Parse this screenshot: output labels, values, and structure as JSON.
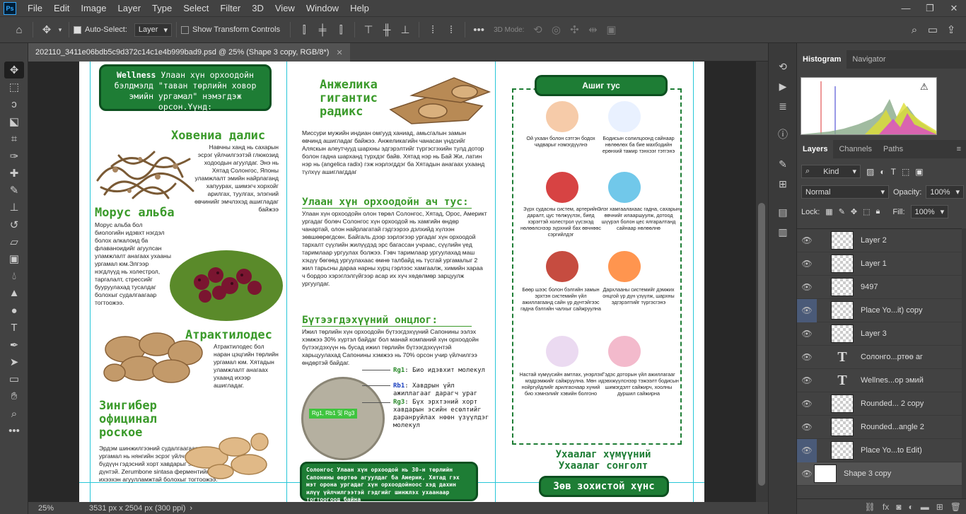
{
  "menubar": {
    "logo": "Ps",
    "items": [
      "File",
      "Edit",
      "Image",
      "Layer",
      "Type",
      "Select",
      "Filter",
      "3D",
      "View",
      "Window",
      "Help"
    ]
  },
  "options": {
    "auto_select_label": "Auto-Select:",
    "auto_select_value": "Layer",
    "transform_controls_label": "Show Transform Controls",
    "mode_3d_label": "3D Mode:"
  },
  "document": {
    "tab_title": "202110_3411e06bdb5c9d372c14c1e4b999bad9.psd @ 25% (Shape 3 copy, RGB/8*)",
    "zoom": "25%",
    "dimensions": "3531 px x 2504 px (300 ppi)"
  },
  "panels": {
    "histogram_tab": "Histogram",
    "navigator_tab": "Navigator",
    "layers_tab": "Layers",
    "channels_tab": "Channels",
    "paths_tab": "Paths",
    "kind_label": "Kind",
    "blend_mode": "Normal",
    "opacity_label": "Opacity:",
    "opacity_value": "100%",
    "lock_label": "Lock:",
    "fill_label": "Fill:",
    "fill_value": "100%"
  },
  "layers": [
    {
      "name": "Layer 2",
      "type": "pixel",
      "hl": false
    },
    {
      "name": "Layer 1",
      "type": "pixel",
      "hl": false
    },
    {
      "name": "9497",
      "type": "pixel",
      "hl": false
    },
    {
      "name": "Place Yo...it) copy",
      "type": "smart",
      "hl": true
    },
    {
      "name": "Layer 3",
      "type": "pixel",
      "hl": false
    },
    {
      "name": "Солонго...ртөө аг",
      "type": "text",
      "hl": false
    },
    {
      "name": "Wellnes...ор эмий",
      "type": "text",
      "hl": false
    },
    {
      "name": "Rounded... 2 copy",
      "type": "smart",
      "hl": false
    },
    {
      "name": "Rounded...angle 2",
      "type": "smart",
      "hl": false
    },
    {
      "name": "Place Yo...to Edit)",
      "type": "smart",
      "hl": true
    },
    {
      "name": "Shape 3 copy",
      "type": "shape",
      "hl": false,
      "sel": true
    }
  ],
  "canvas": {
    "header_box": {
      "brand": "Wellness",
      "text": "Улаан хүн орхоодойн бэлдмэлд \"таван төрлийн ховор эмийн ургамал\" нэмэгдэж орсон.Үүнд:"
    },
    "hovenia": {
      "title": "Ховениа далис",
      "text": "Навчны ханд нь сахарын эсрэг үйлчилгээтэй глюкозид ходоодын агуулдаг. Энэ нь Хятад Солонгос, Японы уламжлалт эмийн найрлаганд хапуурах, шимэгч хорхойг арилгах, туулгах, элэгний өвчинийг эмчлэхэд ашигладаг байжээ"
    },
    "morus": {
      "title": "Морус альба",
      "text": "Морус альба бол биологийн идэвхт нэгдэл болох алкалоид ба флаваноидийг агуулсан уламжлалт анагаах ухааны ургамал юм.Элгээр нэгдлүүд нь холестрол, таргалалт, стрессийг бууруулахад тусалдаг болохыг судалгаагаар тогтоожээ."
    },
    "atractylodes": {
      "title": "Атрактилодес",
      "text": "Атрактилодес бол наран цэцгийн төрлийн ургамал юм. Хятадын уламжлалт анагаах ухаанд ихээр ашигладаг."
    },
    "zingiber": {
      "title": "Зингибер официнал роское",
      "text": "Эрдэм шинжилгээний судалгаагаар энэ ургамал нь нянгийн эсрэг үйлчилгээтэй, мөн бүдүүн гэдэсний хорт хавдарыг эмчилхэд үр дүнтэй. Zerumbone sintasa ферментийн ихээхэн агуулламжтай болохыг тогтоожээ."
    },
    "angelica": {
      "title": "Анжелика гигантис радикс",
      "text": "Миссури мужийн индиан омгууд ханиад, амьсгалын замын өвчинд ашигладаг байжээ. Анжеликагийн чанасан үндсийг Аляскын алеутчууд шархны эдгэрэлтийг түргэсгэхийн тулд дотор болон гадна шарханд түрхдэг байв. Хятад нэр нь Бай Жи, латин нэр нь (angelica radix) гэж нэрлэгддэг ба Хятадын анагаах ухаанд түлхүү ашиглагддаг"
    },
    "benefit_sec": {
      "title": "Улаан хүн орхоодойн ач тус:",
      "text": "Улаан хүн орхоодойн олон төрөл Солонгос, Хятад, Орос, Америкт ургадаг болөч Солонгос хүн орхоодой нь хамгийн өндөр чанартай, олон найрлагатай гэдгээрээ дэлхийд хүлээн зөвшөөрөгдсөн. Байгаль дээр зэрлэгээр ургадаг хүн орхоодой тархалт сүүлийн жилүүдэд эрс багассан учраас, сүүлийн үед таримлаар ургуулах болжээ. Гэвч таримлаар ургуулахад маш хэцүү бөгөөд ургуулахаас өмнө талбайд нь түсгай ургамалыг 2 жил тарьсны дараа нарны хурц гэрлээс хамгаалж, химийн хараа ч бордоо хэрэглэлгүйгээр асар их хүч хөдөлмөр зарцуулж ургуулдаг."
    },
    "content_sec": {
      "title": "Бүтээгдэхүүний онцлог:",
      "text": "Ижил төрлийн хүн орхоодойн бүтээгдэхүүний Сапонины ээлэх хэмжээ 30% хүртэл байдаг бол манай компаний хүн орхоодойн бүтээгдэхүүн нь бусад ижил төрлийн бүтээгдэхүүнтэй харьцуулахад Сапонины хэмжээ нь 70% орсон учир үйлчилгээ өндөртэй байдаг."
    },
    "rg": [
      {
        "key": "Rg1",
        "text": ": Био идэвхит молекул"
      },
      {
        "key": "Rb1",
        "text": ": Хавдрын үйл ажиллагааг дарагч ураг"
      },
      {
        "key": "Rg3",
        "text": ": Бүх эрхтэний хорт хавдарын эсийн есөлтийг даранруйлах нөөн үзүүлдэг молекул"
      }
    ],
    "lens_text": "Rg1, Rb1 및 Rg3",
    "bottom_box": "Солонгос Улаан хүн орхоодой нь 30-н төрлийн Сапонины өөртөө агуулдаг ба Америк, Хятад гэх мэт орона ургадаг хүн орхоодойноос хэд дахин илүү үйлчилгээтэй гэдгийг шинжлэх ухаанаар тогтоогоод байна",
    "ashig": {
      "title": "Ашиг тус",
      "items": [
        "Ой ухаан болон сэтгэн бодох чадварыг нэмэгдүүлнэ",
        "Бодисын солилцоонд сайнаар нөлөөлөх ба бие махбодийн ерөнхий тамир тэнхээг тэтгэнэ",
        "Зүрх судасны систем, артерийн даралт, цус төлжүүлэх, биед хэрэгтэй холестрол үүсэхэд нөлөөлснээр зүрхний бах өвчнөөс сэргийлдэг",
        "Элэг хамгаалахаас гадна, сахарын өвчнийг илааршуулж, дотоод шүүрэл болон цес ялгаралтанд сайнаар нөлөөлнө",
        "Бөөр шээс болон бэлгийн замын эрхтэн системийн үйл ажиллагаанд сайн үр дүнтэйгээс гадна бэлгийн чалхыг сайжруулна",
        "Дархлааны системийг дэмжих онцгой үр дүн үзүүлж, шархны эдгэрэлтийг түргэсгэнэ",
        "Настай хүмүүсийн амтлах, унэрлэх мэдрэмжийг сайжруулна. Мөн нойргүйдлийг арилгаснаар хүний био хэмнэлийг хэвийн болгоно",
        "Гэдэс доторын үйл ажиллагааг идэвхжүүлснээр тэжээлт бодисын шимэгдэлт сайжирч, хоолны дуршил сайжирна"
      ]
    },
    "wise1": "Ухаалаг хүмүүний",
    "wise2": "Ухаалаг сонголт",
    "wise_box": "Зөв зохистой хүнс"
  }
}
